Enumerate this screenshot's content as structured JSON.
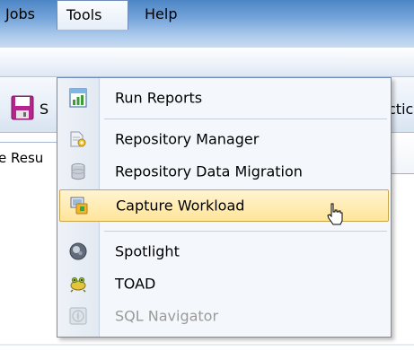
{
  "menubar": {
    "jobs": "Jobs",
    "tools": "Tools",
    "help": "Help"
  },
  "toolbar": {
    "save_partial": "S",
    "right_partial": "ctic"
  },
  "tabs": {
    "left_partial": "e Resu"
  },
  "dropdown": {
    "items": [
      {
        "label": "Run Reports",
        "icon": "report-icon",
        "state": "normal"
      },
      {
        "label": "Repository Manager",
        "icon": "repository-manager-icon",
        "state": "normal"
      },
      {
        "label": "Repository Data Migration",
        "icon": "data-migration-icon",
        "state": "normal"
      },
      {
        "label": "Capture Workload",
        "icon": "capture-workload-icon",
        "state": "highlighted"
      },
      {
        "label": "Spotlight",
        "icon": "spotlight-icon",
        "state": "normal"
      },
      {
        "label": "TOAD",
        "icon": "toad-icon",
        "state": "normal"
      },
      {
        "label": "SQL Navigator",
        "icon": "sql-navigator-icon",
        "state": "disabled"
      }
    ]
  },
  "colors": {
    "highlight_top": "#fff4d1",
    "highlight_bottom": "#ffe59a",
    "highlight_border": "#c8a64a",
    "menu_border": "#6f8db8",
    "disabled_text": "#9a9a9a"
  }
}
